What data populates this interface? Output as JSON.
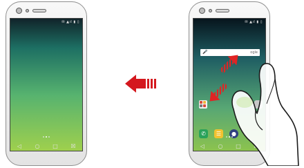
{
  "left_phone": {
    "status_text": "✉ ▲ıl ▮ ▯",
    "page_dots": [
      false,
      true,
      false
    ],
    "nav": {
      "back": "◁",
      "home": "○",
      "recent": "□",
      "extra": "☒"
    }
  },
  "right_phone": {
    "status_text": "✉ ▲ıl ▮ ▯",
    "search": {
      "mic": "🎤",
      "brand": "ogle"
    },
    "dock": {
      "phone": "✆",
      "message": "☰",
      "camera": "●"
    },
    "page_dots": [
      false,
      true,
      false
    ],
    "nav": {
      "back": "◁",
      "home": "○",
      "recent": "□",
      "extra": "☒"
    }
  },
  "colors": {
    "arrow_red": "#d4181e",
    "gesture_red": "#e02424",
    "hand_fill": "#ffffff",
    "hand_shadow": "#c8e9a0"
  },
  "icons": {
    "direction_arrow": "left-arrow-icon",
    "pinch_arrows": "diagonal-double-arrow-icon",
    "hand": "pinch-hand-icon"
  }
}
